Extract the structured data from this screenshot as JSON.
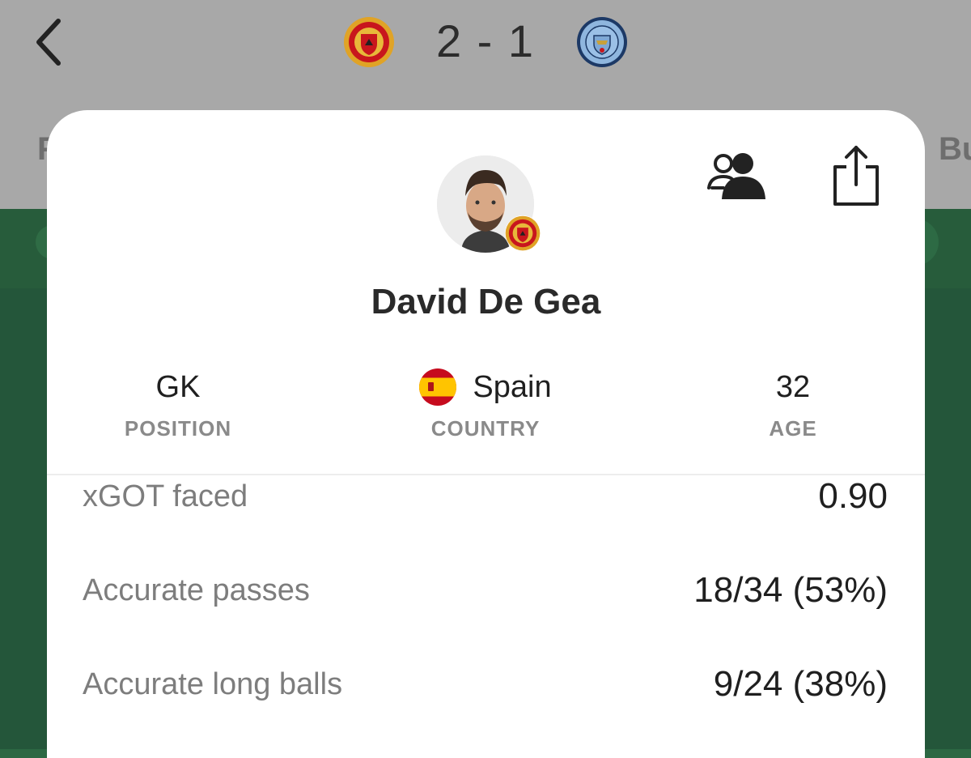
{
  "header": {
    "score": "2 - 1",
    "home_crest_icon": "manchester-united-crest-icon",
    "away_crest_icon": "manchester-city-crest-icon",
    "back_icon": "chevron-left-icon",
    "bg_tab_left": "F",
    "bg_tab_right": "Bu"
  },
  "player": {
    "name": "David De Gea",
    "team_badge_icon": "manchester-united-crest-icon",
    "position": {
      "value": "GK",
      "label": "POSITION"
    },
    "country": {
      "value": "Spain",
      "label": "COUNTRY",
      "flag_icon": "spain-flag-icon"
    },
    "age": {
      "value": "32",
      "label": "AGE"
    }
  },
  "actions": {
    "compare_icon": "people-compare-icon",
    "share_icon": "share-icon"
  },
  "stats": [
    {
      "label": "xGOT faced",
      "value": "0.90"
    },
    {
      "label": "Accurate passes",
      "value": "18/34 (53%)"
    },
    {
      "label": "Accurate long balls",
      "value": "9/24 (38%)"
    }
  ],
  "colors": {
    "header_bg": "#a8a8a8",
    "pitch_green": "#24563a",
    "sheet_bg": "#ffffff",
    "label_gray": "#8a8a8a"
  }
}
